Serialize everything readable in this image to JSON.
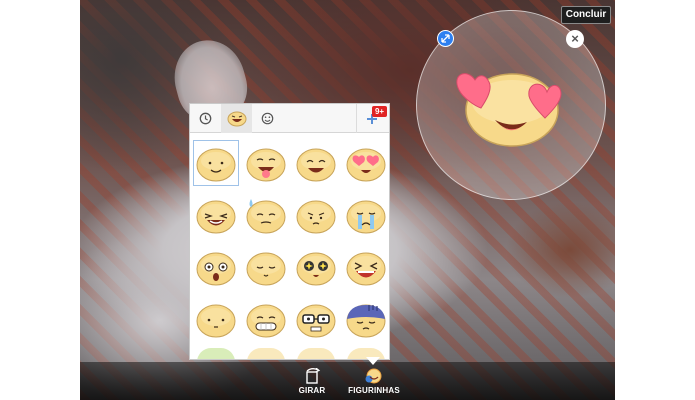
{
  "editor": {
    "done_label": "Concluir",
    "close_glyph": "×"
  },
  "picker": {
    "tabs": [
      {
        "name": "recent",
        "icon": "clock-icon",
        "active": false
      },
      {
        "name": "pack",
        "icon": "sticker-pack-icon",
        "active": true
      },
      {
        "name": "emoji",
        "icon": "smiley-icon",
        "active": false
      }
    ],
    "store_badge": "9+",
    "stickers": [
      {
        "name": "smile"
      },
      {
        "name": "tongue-out"
      },
      {
        "name": "happy"
      },
      {
        "name": "heart-eyes"
      },
      {
        "name": "laughing"
      },
      {
        "name": "sweat"
      },
      {
        "name": "unsure"
      },
      {
        "name": "crying"
      },
      {
        "name": "shocked"
      },
      {
        "name": "sleepy"
      },
      {
        "name": "star-eyes"
      },
      {
        "name": "squint-laugh"
      },
      {
        "name": "meh"
      },
      {
        "name": "grin"
      },
      {
        "name": "nerd"
      },
      {
        "name": "gloom"
      }
    ]
  },
  "toolbar": {
    "rotate_label": "GIRAR",
    "stickers_label": "FIGURINHAS"
  },
  "colors": {
    "sticker_face": "#f7d98a",
    "heart": "#ff6d8a",
    "accent_blue": "#2d7ff0",
    "badge_red": "#e02424"
  }
}
